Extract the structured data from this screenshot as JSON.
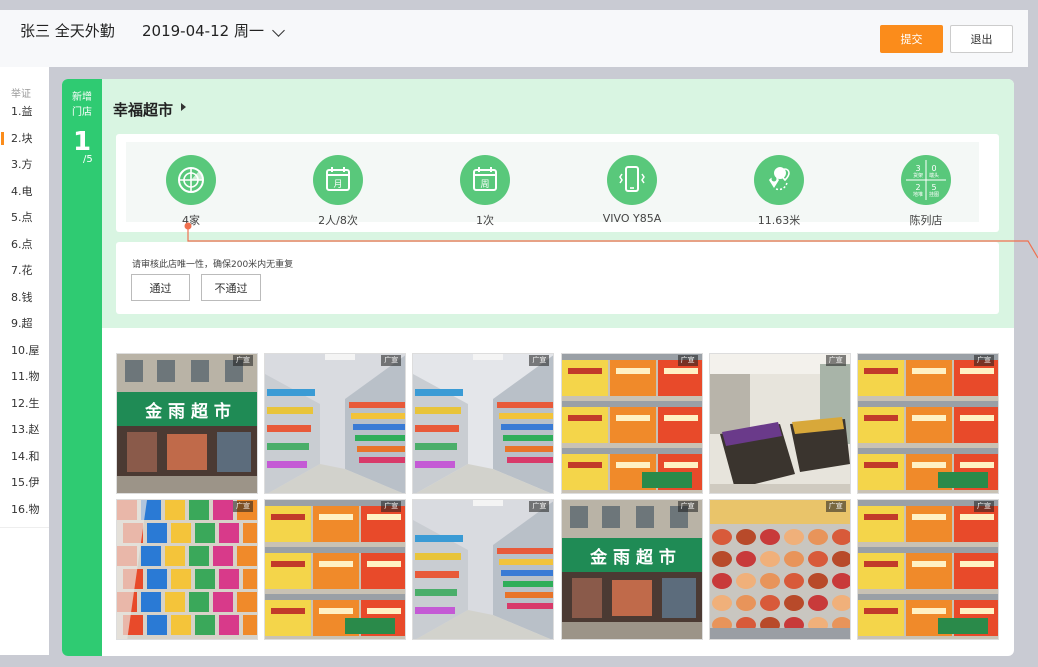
{
  "header": {
    "user_title": "张三 全天外勤",
    "date": "2019-04-12 周一",
    "submit_label": "提交",
    "exit_label": "退出"
  },
  "sidebar": {
    "heading": "举证",
    "items": [
      {
        "label": "1.益"
      },
      {
        "label": "2.块"
      },
      {
        "label": "3.方"
      },
      {
        "label": "4.电"
      },
      {
        "label": "5.点"
      },
      {
        "label": "6.点"
      },
      {
        "label": "7.花"
      },
      {
        "label": "8.钱"
      },
      {
        "label": "9.超"
      },
      {
        "label": "10.屋"
      },
      {
        "label": "11.物"
      },
      {
        "label": "12.生"
      },
      {
        "label": "13.赵"
      },
      {
        "label": "14.和"
      },
      {
        "label": "15.伊"
      },
      {
        "label": "16.物"
      }
    ],
    "active_index": 1
  },
  "card": {
    "tag_line1": "新增",
    "tag_line2": "门店",
    "index": "1",
    "total": "/5",
    "store_name": "幸福超市",
    "stats": [
      {
        "icon": "radar-icon",
        "value": "4家"
      },
      {
        "icon": "calendar-month-icon",
        "icon_text": "月",
        "value": "2人/8次"
      },
      {
        "icon": "calendar-week-icon",
        "icon_text": "周",
        "value": "1次"
      },
      {
        "icon": "phone-vibrate-icon",
        "value": "VIVO Y85A"
      },
      {
        "icon": "location-distance-icon",
        "value": "11.63米"
      },
      {
        "icon": "display-grid-icon",
        "grid": [
          [
            "3",
            "货架"
          ],
          [
            "0",
            "端头"
          ],
          [
            "2",
            "地堆"
          ],
          [
            "5",
            "挂图"
          ]
        ],
        "value": "陈列店"
      }
    ],
    "review_text": "请审核此店唯一性，确保200米内无重复",
    "pass_label": "通过",
    "fail_label": "不通过"
  },
  "photos": {
    "tag": "广宣",
    "items": [
      {
        "kind": "storefront",
        "sign": "金 雨 超 市"
      },
      {
        "kind": "aisle"
      },
      {
        "kind": "aisle-wide"
      },
      {
        "kind": "boxes"
      },
      {
        "kind": "bins"
      },
      {
        "kind": "boxes"
      },
      {
        "kind": "snacks"
      },
      {
        "kind": "boxes"
      },
      {
        "kind": "aisle"
      },
      {
        "kind": "storefront",
        "sign": "金 雨 超 市"
      },
      {
        "kind": "meat"
      },
      {
        "kind": "boxes"
      }
    ]
  },
  "colors": {
    "accent": "#fb8c1b",
    "green": "#2fcb72",
    "green_icon": "#59c87b",
    "mint_bg": "#d9f5e2",
    "pointer_line": "#f0704f"
  }
}
